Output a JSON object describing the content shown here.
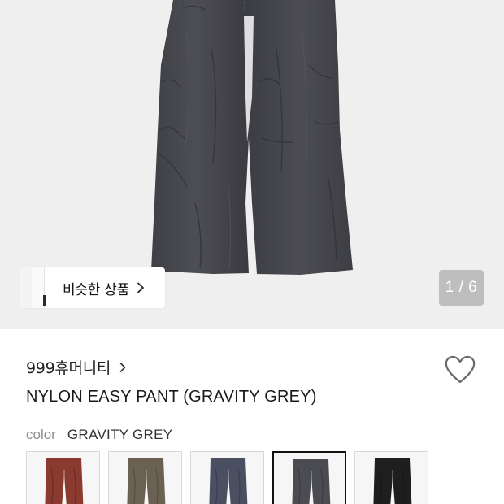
{
  "gallery": {
    "similar_label": "비슷한 상품",
    "counter": "1 / 6",
    "background": "#efefef"
  },
  "product": {
    "brand": "999휴머니티",
    "name": "NYLON EASY PANT (GRAVITY GREY)",
    "color_label": "color",
    "color_value": "GRAVITY GREY",
    "wishlisted": false
  },
  "color_options": [
    {
      "name": "rust-red",
      "color": "#8a3a2e",
      "selected": false
    },
    {
      "name": "khaki-brown",
      "color": "#6b6152",
      "selected": false
    },
    {
      "name": "slate-blue",
      "color": "#4a5061",
      "selected": false
    },
    {
      "name": "gravity-grey",
      "color": "#4b4c52",
      "selected": true
    },
    {
      "name": "black",
      "color": "#1e1e1f",
      "selected": false
    }
  ],
  "icons": {
    "similar": "chevron-right-icon",
    "brand": "chevron-right-icon",
    "wishlist": "heart-icon"
  }
}
